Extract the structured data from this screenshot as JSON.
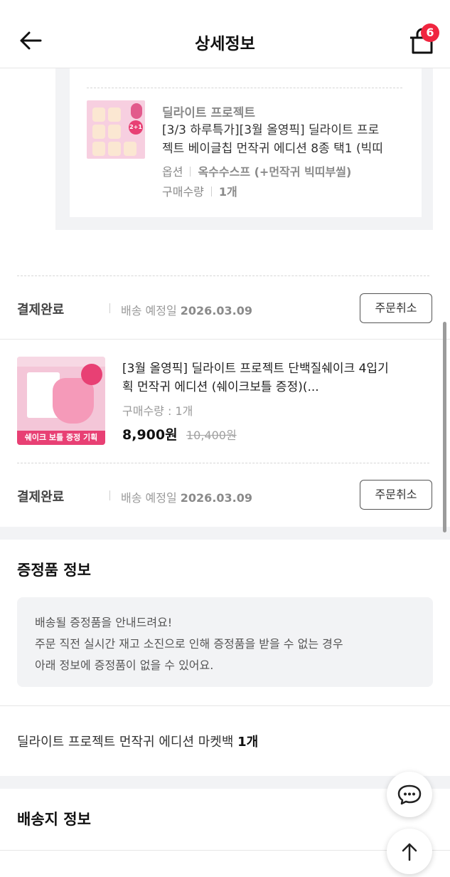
{
  "header": {
    "title": "상세정보",
    "cart_count": "6"
  },
  "gift_product": {
    "brand": "딜라이트 프로젝트",
    "name_line1": "[3/3 하루특가][3월 올영픽] 딜라이트 프로",
    "name_line2": "젝트 베이글칩 먼작귀 에디션 8종 택1 (빅띠",
    "option_label": "옵션",
    "option_value": "옥수수스프 (+먼작귀 빅띠부씰)",
    "qty_label": "구매수량",
    "qty_value": "1개",
    "thumb_badge": "2+1"
  },
  "order_status_1": {
    "status": "결제완료",
    "ship_label": "배송 예정일",
    "ship_date": "2026.03.09",
    "cancel_label": "주문취소"
  },
  "product_2": {
    "name": "[3월 올영픽] 딜라이트 프로젝트 단백질쉐이크 4입기획 먼작귀 에디션 (쉐이크보틀 증정)(...",
    "qty": "구매수량 : 1개",
    "price": "8,900원",
    "original_price": "10,400원",
    "thumb_banner": "쉐이크 보틀 증정 기획"
  },
  "order_status_2": {
    "status": "결제완료",
    "ship_label": "배송 예정일",
    "ship_date": "2026.03.09",
    "cancel_label": "주문취소"
  },
  "freebie": {
    "title": "증정품 정보",
    "notice_lines": [
      "배송될 증정품을 안내드려요!",
      "주문 직전 실시간 재고 소진으로 인해 증정품을 받을 수 없는 경우",
      "아래 정보에 증정품이 없을 수 있어요."
    ],
    "item_name": "딜라이트 프로젝트 먼작귀 에디션 마켓백",
    "item_qty": "1개"
  },
  "shipping": {
    "title": "배송지 정보"
  },
  "icons": {
    "back": "arrow-left-icon",
    "cart": "shopping-bag-icon",
    "chat": "chat-bubble-icon",
    "top": "arrow-up-icon"
  }
}
